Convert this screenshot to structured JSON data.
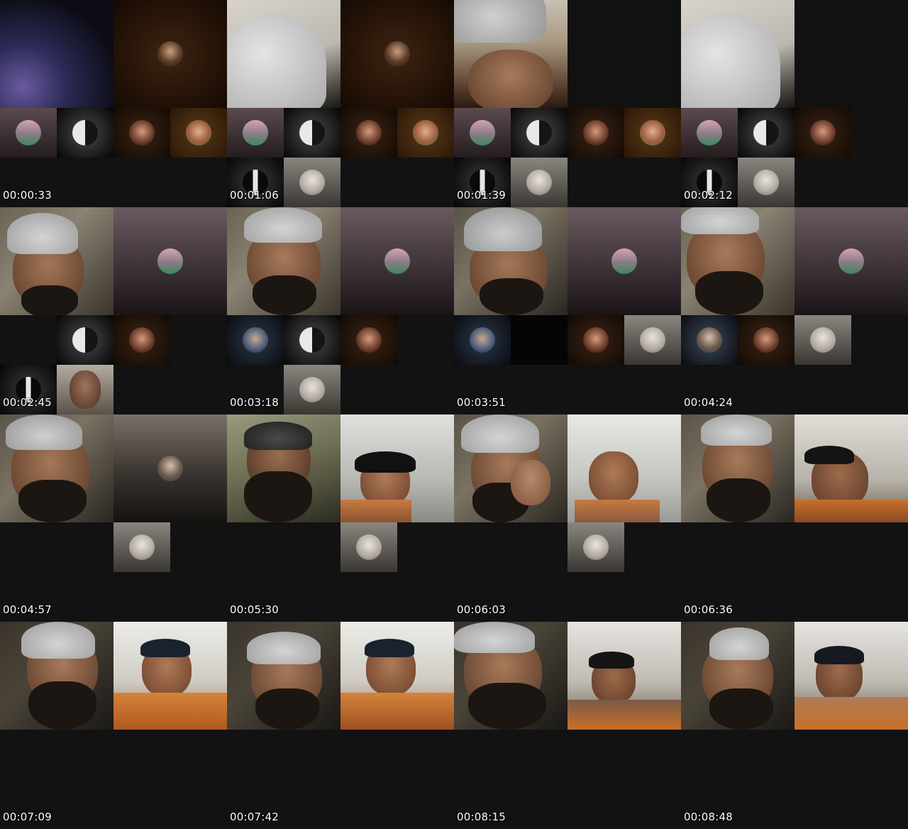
{
  "contact_sheet": {
    "timestamps": [
      "00:00:33",
      "00:01:06",
      "00:01:39",
      "00:02:12",
      "00:02:45",
      "00:03:18",
      "00:03:51",
      "00:04:24",
      "00:04:57",
      "00:05:30",
      "00:06:03",
      "00:06:36",
      "00:07:09",
      "00:07:42",
      "00:08:15",
      "00:08:48"
    ]
  },
  "colors": {
    "background": "#111111",
    "timestamp_text": "#ffffff"
  }
}
